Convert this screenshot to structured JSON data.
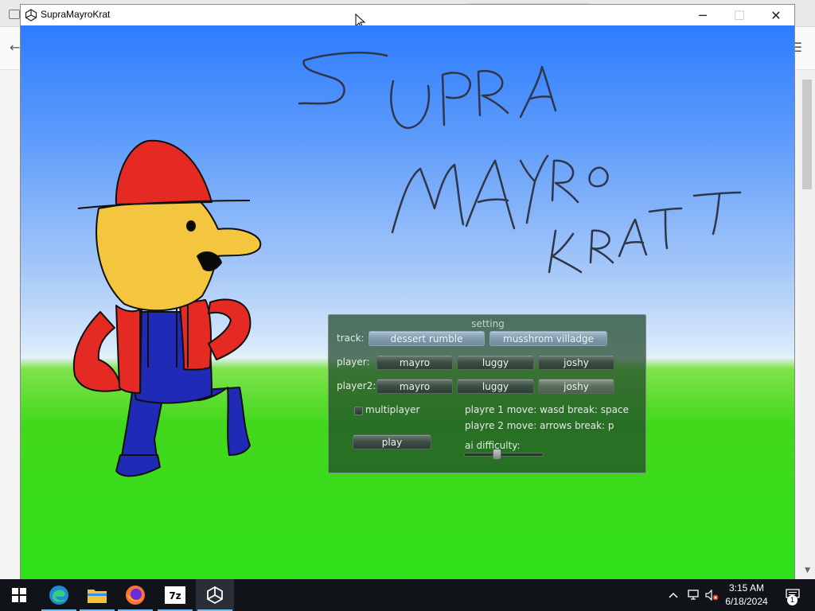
{
  "window": {
    "title": "SupraMayroKrat",
    "minimize_glyph": "─",
    "maximize_glyph": "☐",
    "close_glyph": "✕"
  },
  "panel": {
    "title": "setting",
    "track_label": "track:",
    "tracks": [
      "dessert rumble",
      "musshrom villadge"
    ],
    "player_label": "player:",
    "player2_label": "player2:",
    "characters": [
      "mayro",
      "luggy",
      "joshy"
    ],
    "multiplayer_label": "multiplayer",
    "play_label": "play",
    "p1_controls": "playre 1 move: wasd break: space",
    "p2_controls": "playre 2 move: arrows break: p",
    "ai_label": "ai difficulty:",
    "ai_difficulty": 0.4
  },
  "taskbar": {
    "items": [
      "windows-start-icon",
      "edge-icon",
      "file-explorer-icon",
      "firefox-icon",
      "7zip-icon",
      "unity-icon"
    ],
    "time": "3:15 AM",
    "date": "6/18/2024",
    "notification_count": "1"
  }
}
